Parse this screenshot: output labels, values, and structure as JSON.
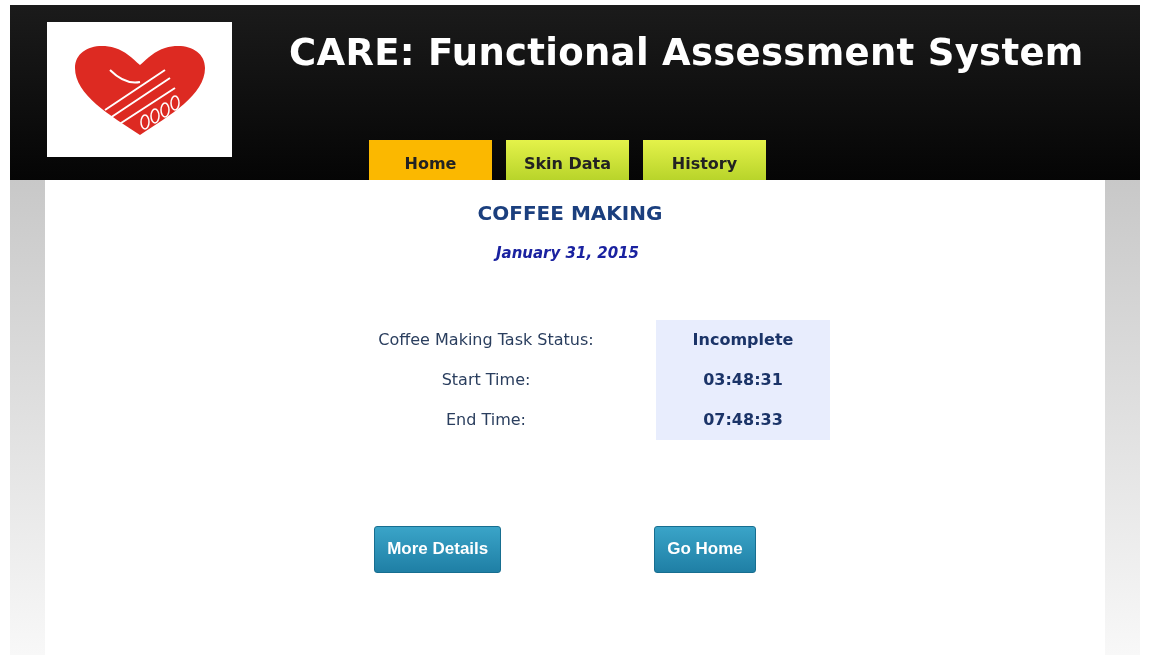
{
  "header": {
    "title": "CARE: Functional Assessment System"
  },
  "tabs": [
    {
      "label": "Home",
      "selected": true
    },
    {
      "label": "Skin Data",
      "selected": false
    },
    {
      "label": "History",
      "selected": false
    }
  ],
  "task": {
    "title": "COFFEE MAKING",
    "date": "January 31, 2015"
  },
  "details": [
    {
      "label": "Coffee Making Task Status:",
      "value": "Incomplete"
    },
    {
      "label": "Start Time:",
      "value": "03:48:31"
    },
    {
      "label": "End Time:",
      "value": "07:48:33"
    }
  ],
  "buttons": [
    "More Details",
    "Go Home"
  ]
}
